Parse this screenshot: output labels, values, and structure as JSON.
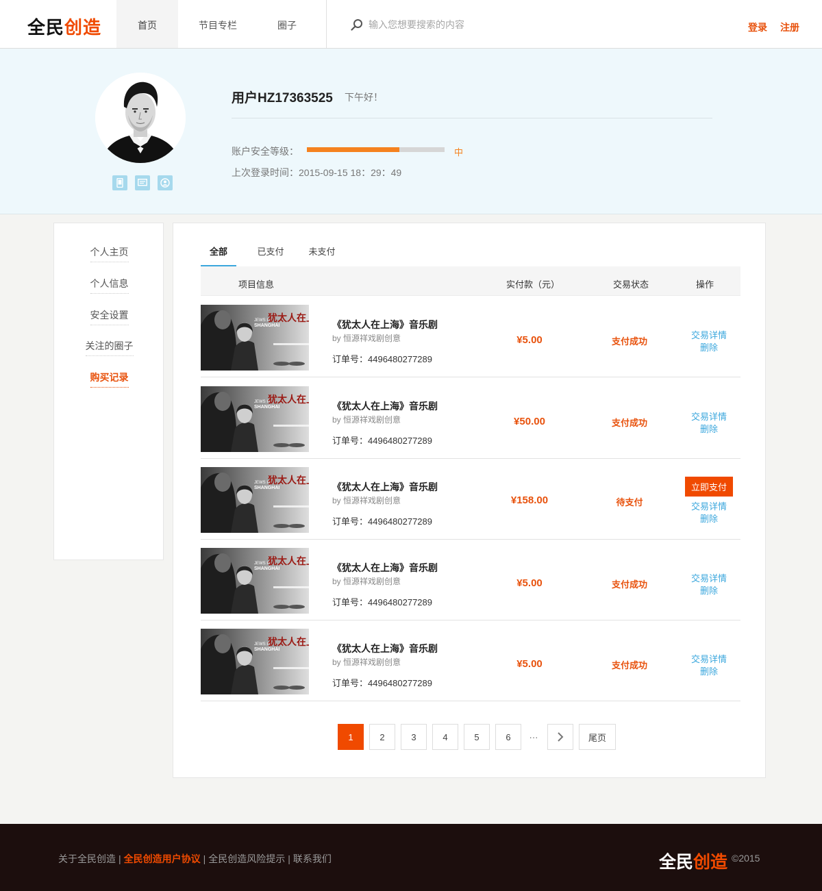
{
  "brand": {
    "name_dark": "全民",
    "name_accent": "创造",
    "accent_color": "#f04a00"
  },
  "nav": {
    "items": [
      {
        "label": "首页",
        "active": true
      },
      {
        "label": "节目专栏",
        "active": false
      },
      {
        "label": "圈子",
        "active": false
      }
    ]
  },
  "search": {
    "placeholder": "输入您想要搜索的内容",
    "icon": "search-icon"
  },
  "auth": {
    "login": "登录",
    "register": "注册"
  },
  "profile": {
    "username": "用户HZ17363525",
    "greeting": "下午好！",
    "security_label": "账户安全等级：",
    "security_level": "中",
    "security_fraction": 0.67,
    "last_login": "上次登录时间：2015-09-15 18：29：49",
    "bind_icons": [
      "phone-icon",
      "message-icon",
      "user-icon"
    ]
  },
  "sidebar": {
    "items": [
      {
        "label": "个人主页",
        "active": false
      },
      {
        "label": "个人信息",
        "active": false
      },
      {
        "label": "安全设置",
        "active": false
      },
      {
        "label": "关注的圈子",
        "active": false
      },
      {
        "label": "购买记录",
        "active": true
      }
    ]
  },
  "tabs": [
    {
      "label": "全部",
      "active": true
    },
    {
      "label": "已支付",
      "active": false
    },
    {
      "label": "未支付",
      "active": false
    }
  ],
  "table": {
    "headers": {
      "project": "项目信息",
      "amount": "实付款（元）",
      "status": "交易状态",
      "ops": "操作"
    },
    "rows": [
      {
        "title": "《犹太人在上海》音乐剧",
        "by": "by 恒源祥戏剧创意",
        "order": "订单号：4496480277289",
        "price": "¥5.00",
        "status": "支付成功",
        "pay_label": "",
        "detail": "交易详情",
        "delete": "删除"
      },
      {
        "title": "《犹太人在上海》音乐剧",
        "by": "by 恒源祥戏剧创意",
        "order": "订单号：4496480277289",
        "price": "¥50.00",
        "status": "支付成功",
        "pay_label": "",
        "detail": "交易详情",
        "delete": "删除"
      },
      {
        "title": "《犹太人在上海》音乐剧",
        "by": "by 恒源祥戏剧创意",
        "order": "订单号：4496480277289",
        "price": "¥158.00",
        "status": "待支付",
        "pay_label": "立即支付",
        "detail": "交易详情",
        "delete": "删除"
      },
      {
        "title": "《犹太人在上海》音乐剧",
        "by": "by 恒源祥戏剧创意",
        "order": "订单号：4496480277289",
        "price": "¥5.00",
        "status": "支付成功",
        "pay_label": "",
        "detail": "交易详情",
        "delete": "删除"
      },
      {
        "title": "《犹太人在上海》音乐剧",
        "by": "by 恒源祥戏剧创意",
        "order": "订单号：4496480277289",
        "price": "¥5.00",
        "status": "支付成功",
        "pay_label": "",
        "detail": "交易详情",
        "delete": "删除"
      }
    ]
  },
  "poster": {
    "art_text": "犹太人在上海",
    "small_text_1": "JEWS IN",
    "small_text_2": "SHANGHAI"
  },
  "pagination": {
    "pages": [
      "1",
      "2",
      "3",
      "4",
      "5",
      "6"
    ],
    "current": "1",
    "ellipsis": "···",
    "last": "尾页"
  },
  "footer": {
    "links": [
      {
        "label": "关于全民创造",
        "highlight": false
      },
      {
        "label": "全民创造用户协议",
        "highlight": true
      },
      {
        "label": "全民创造风险提示",
        "highlight": false
      },
      {
        "label": "联系我们",
        "highlight": false
      }
    ],
    "separator": "|",
    "copyright": "©2015"
  }
}
